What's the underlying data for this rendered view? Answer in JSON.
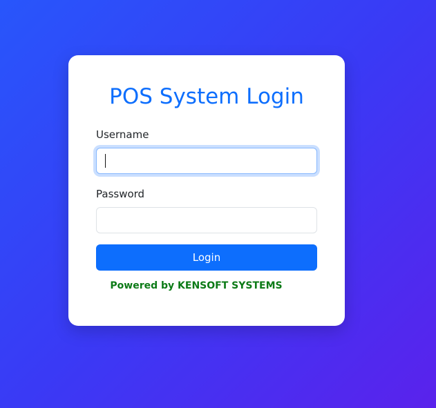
{
  "login": {
    "title": "POS System Login",
    "username_label": "Username",
    "username_value": "",
    "password_label": "Password",
    "password_value": "",
    "login_button": "Login",
    "powered_by": "Powered by KENSOFT SYSTEMS"
  },
  "colors": {
    "accent": "#0d6efd",
    "powered_by": "#0b7a16",
    "background_start": "#2856fb",
    "background_end": "#5a22ec"
  }
}
